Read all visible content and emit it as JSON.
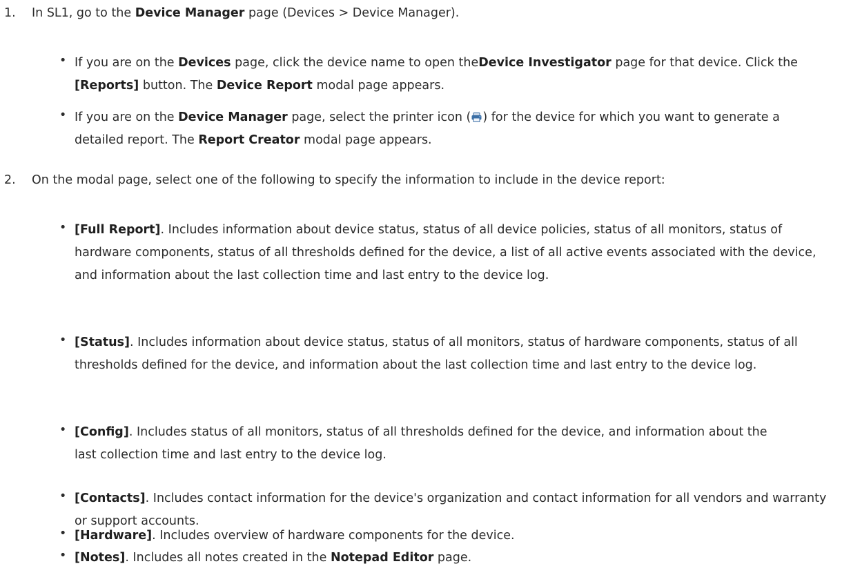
{
  "steps": [
    {
      "number": "1.",
      "segments": [
        {
          "text": "In SL1, go to the ",
          "bold": false
        },
        {
          "text": "Device Manager",
          "bold": true
        },
        {
          "text": " page (Devices > Device Manager).",
          "bold": false
        }
      ],
      "bullets": [
        {
          "segments": [
            {
              "text": "If you are on the ",
              "bold": false
            },
            {
              "text": "Devices",
              "bold": true
            },
            {
              "text": " page, click the device name to open the",
              "bold": false
            },
            {
              "text": "Device Investigator",
              "bold": true
            },
            {
              "text": " page for that device. Click the ",
              "bold": false
            },
            {
              "text": "[Reports]",
              "bold": true
            },
            {
              "text": " button. The ",
              "bold": false
            },
            {
              "text": "Device Report",
              "bold": true
            },
            {
              "text": " modal page appears.",
              "bold": false
            }
          ]
        },
        {
          "segments": [
            {
              "text": "If you are on the ",
              "bold": false
            },
            {
              "text": "Device Manager",
              "bold": true
            },
            {
              "text": " page, select the printer icon (",
              "bold": false
            },
            {
              "icon": "printer-icon"
            },
            {
              "text": ") for the device for which you want to generate a detailed report. The ",
              "bold": false
            },
            {
              "text": "Report Creator",
              "bold": true
            },
            {
              "text": " modal page appears.",
              "bold": false
            }
          ]
        }
      ]
    },
    {
      "number": "2.",
      "segments": [
        {
          "text": "On the modal page, select one of the following to specify the information to include in the device report:",
          "bold": false
        }
      ],
      "bullets": [
        {
          "segments": [
            {
              "text": "[Full Report]",
              "bold": true
            },
            {
              "text": ". Includes information about device status, status of all device policies, status of all monitors, status of hardware components, status of all thresholds defined for the device, a list of all active events associated with the device, and information about the last collection time and last entry to the device log.",
              "bold": false
            }
          ]
        },
        {
          "segments": [
            {
              "text": "[Status]",
              "bold": true
            },
            {
              "text": ". Includes information about device status, status of all monitors, status of hardware components, status of all thresholds defined for the device, and information about the last collection time and last entry to the device log.",
              "bold": false
            }
          ]
        },
        {
          "segments": [
            {
              "text": "[Config]",
              "bold": true
            },
            {
              "text": ". Includes status of all monitors, status of all thresholds defined for the device, and information about the last collection time and last entry to the device log.",
              "bold": false
            }
          ]
        },
        {
          "segments": [
            {
              "text": "[Contacts]",
              "bold": true
            },
            {
              "text": ". Includes contact information for the device's organization and contact information for all vendors and warranty or support accounts.",
              "bold": false
            }
          ]
        },
        {
          "segments": [
            {
              "text": "[Hardware]",
              "bold": true
            },
            {
              "text": ". Includes overview of hardware components for the device.",
              "bold": false
            }
          ]
        },
        {
          "segments": [
            {
              "text": "[Notes]",
              "bold": true
            },
            {
              "text": ". Includes all notes created in the ",
              "bold": false
            },
            {
              "text": "Notepad Editor",
              "bold": true
            },
            {
              "text": " page.",
              "bold": false
            }
          ]
        }
      ]
    }
  ],
  "bullet_glyph": "•",
  "colors": {
    "text": "#2b2b2b",
    "printer_icon": "#3a6ea5"
  }
}
